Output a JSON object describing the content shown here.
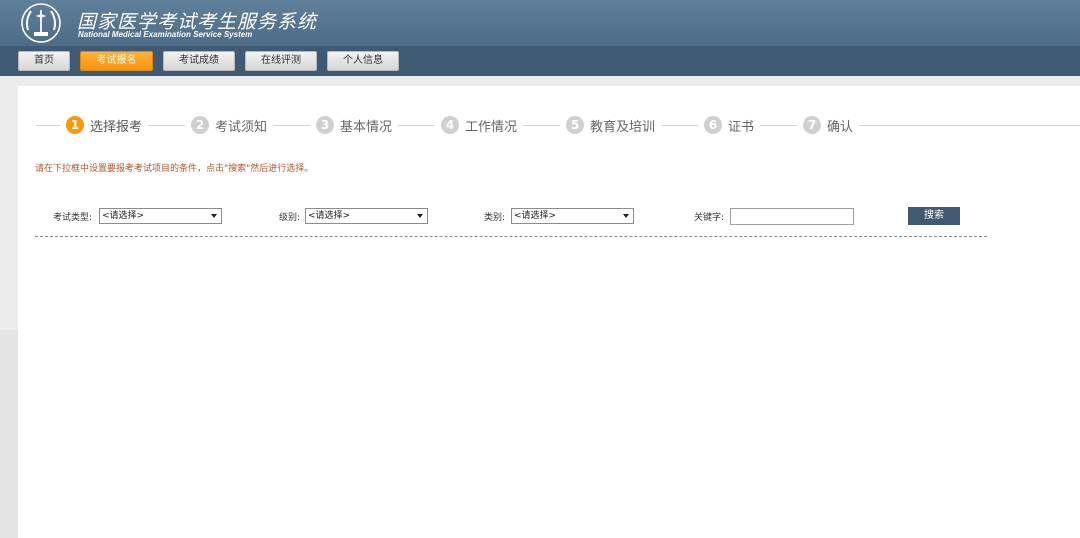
{
  "header": {
    "title_cn": "国家医学考试考生服务系统",
    "title_en": "National Medical Examination Service System"
  },
  "nav": {
    "items": [
      {
        "label": "首页"
      },
      {
        "label": "考试报名"
      },
      {
        "label": "考试成绩"
      },
      {
        "label": "在线评测"
      },
      {
        "label": "个人信息"
      }
    ],
    "active_index": 1
  },
  "steps": [
    {
      "num": "1",
      "label": "选择报考"
    },
    {
      "num": "2",
      "label": "考试须知"
    },
    {
      "num": "3",
      "label": "基本情况"
    },
    {
      "num": "4",
      "label": "工作情况"
    },
    {
      "num": "5",
      "label": "教育及培训"
    },
    {
      "num": "6",
      "label": "证书"
    },
    {
      "num": "7",
      "label": "确认"
    }
  ],
  "notice": "请在下拉框中设置要报考考试项目的条件，点击\"搜索\"然后进行选择。",
  "filters": {
    "exam_type": {
      "label": "考试类型:",
      "value": "<请选择>"
    },
    "level": {
      "label": "级别:",
      "value": "<请选择>"
    },
    "category": {
      "label": "类别:",
      "value": "<请选择>"
    },
    "keyword": {
      "label": "关键字:",
      "value": ""
    }
  },
  "search_button": "搜索",
  "colors": {
    "header": "#4d6c88",
    "navbar": "#3e5b73",
    "active": "#f59a0b",
    "notice": "#b2552a",
    "search_button": "#3f5a71"
  }
}
